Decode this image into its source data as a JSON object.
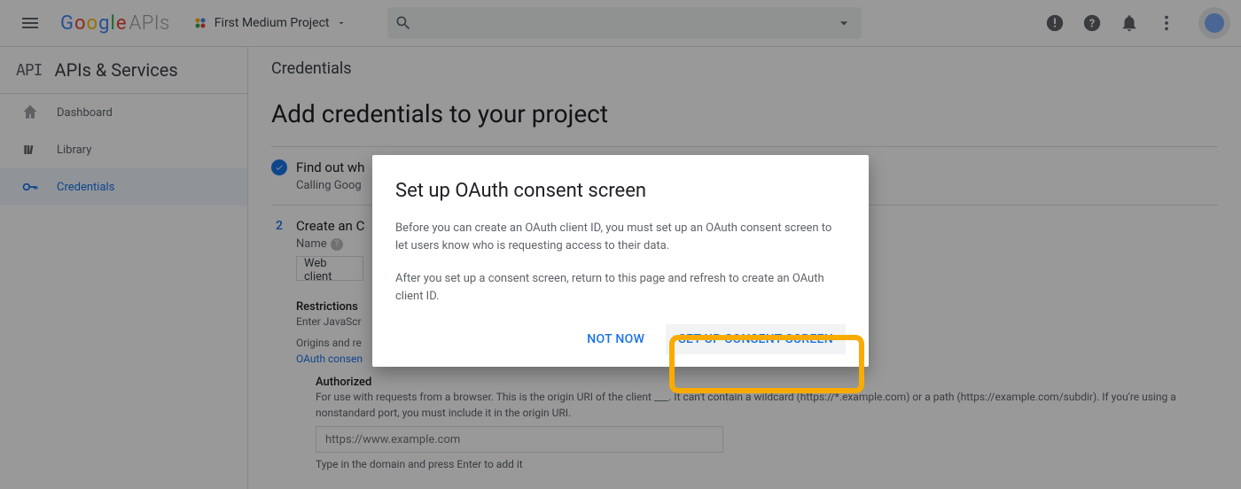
{
  "topbar": {
    "logo_apis": "APIs",
    "project_name": "First Medium Project"
  },
  "sidebar": {
    "api_tag": "API",
    "title": "APIs & Services",
    "items": [
      {
        "label": "Dashboard"
      },
      {
        "label": "Library"
      },
      {
        "label": "Credentials"
      }
    ]
  },
  "content": {
    "page_title": "Credentials",
    "heading": "Add credentials to your project",
    "step1_title": "Find out wh",
    "step1_sub": "Calling Goog",
    "step2_num": "2",
    "step2_title": "Create an C",
    "name_label": "Name",
    "name_value": "Web client",
    "restrictions": "Restrictions",
    "restrict_sub": "Enter JavaScr",
    "restrict_text": "Origins and re",
    "oauth_link": "OAuth consen",
    "authorized": "Authorized",
    "auth_desc": "For use with requests from a browser. This is the origin URI of the client ___. It can't contain a wildcard (https://*.example.com) or a path (https://example.com/subdir). If you're using a nonstandard port, you must include it in the origin URI.",
    "placeholder": "https://www.example.com",
    "hint": "Type in the domain and press Enter to add it"
  },
  "dialog": {
    "title": "Set up OAuth consent screen",
    "p1": "Before you can create an OAuth client ID, you must set up an OAuth consent screen to let users know who is requesting access to their data.",
    "p2": "After you set up a consent screen, return to this page and refresh to create an OAuth client ID.",
    "not_now": "NOT NOW",
    "setup": "SET UP CONSENT SCREEN"
  }
}
